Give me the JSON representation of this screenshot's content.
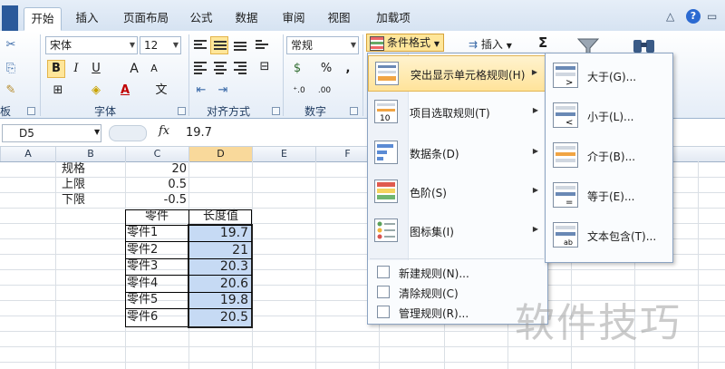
{
  "tabs": [
    "开始",
    "插入",
    "页面布局",
    "公式",
    "数据",
    "审阅",
    "视图",
    "加载项"
  ],
  "window_controls": {
    "minimize": "△",
    "help": "?",
    "restore": "▭",
    "close": "✕"
  },
  "ribbon": {
    "font_name": "宋体",
    "font_size": "12",
    "number_format": "常规",
    "buttons": {
      "bold": "B",
      "italic": "I",
      "underline": "U",
      "grow_font": "A",
      "shrink_font": "A",
      "font_color": "A",
      "percent": "%",
      "comma": ",",
      "currency": "$",
      "insert": "插入",
      "autosum": "Σ"
    },
    "groups": {
      "clipboard_partial": "板",
      "font": "字体",
      "alignment": "对齐方式",
      "number": "数字"
    }
  },
  "formula_bar": {
    "cell_ref": "D5",
    "fx": "fx",
    "value": "19.7"
  },
  "columns": [
    "A",
    "B",
    "C",
    "D",
    "E",
    "F"
  ],
  "sheet": {
    "params": [
      {
        "label": "规格",
        "value": "20"
      },
      {
        "label": "上限",
        "value": "0.5"
      },
      {
        "label": "下限",
        "value": "-0.5"
      }
    ],
    "table_headers": [
      "零件",
      "长度值"
    ],
    "parts": [
      {
        "name": "零件1",
        "length": "19.7"
      },
      {
        "name": "零件2",
        "length": "21"
      },
      {
        "name": "零件3",
        "length": "20.3"
      },
      {
        "name": "零件4",
        "length": "20.6"
      },
      {
        "name": "零件5",
        "length": "19.8"
      },
      {
        "name": "零件6",
        "length": "20.5"
      }
    ]
  },
  "conditional_format": {
    "button_label": "条件格式",
    "menu": [
      "突出显示单元格规则(H)",
      "项目选取规则(T)",
      "数据条(D)",
      "色阶(S)",
      "图标集(I)"
    ],
    "menu_simple": [
      "新建规则(N)...",
      "清除规则(C)",
      "管理规则(R)..."
    ],
    "submenu": [
      "大于(G)...",
      "小于(L)...",
      "介于(B)...",
      "等于(E)...",
      "文本包含(T)..."
    ]
  },
  "watermark": "软件技巧",
  "accent_colors": {
    "ribbon_bg": "#dfe8f5",
    "highlight": "#ffe39a",
    "selection": "#c6daf4"
  }
}
